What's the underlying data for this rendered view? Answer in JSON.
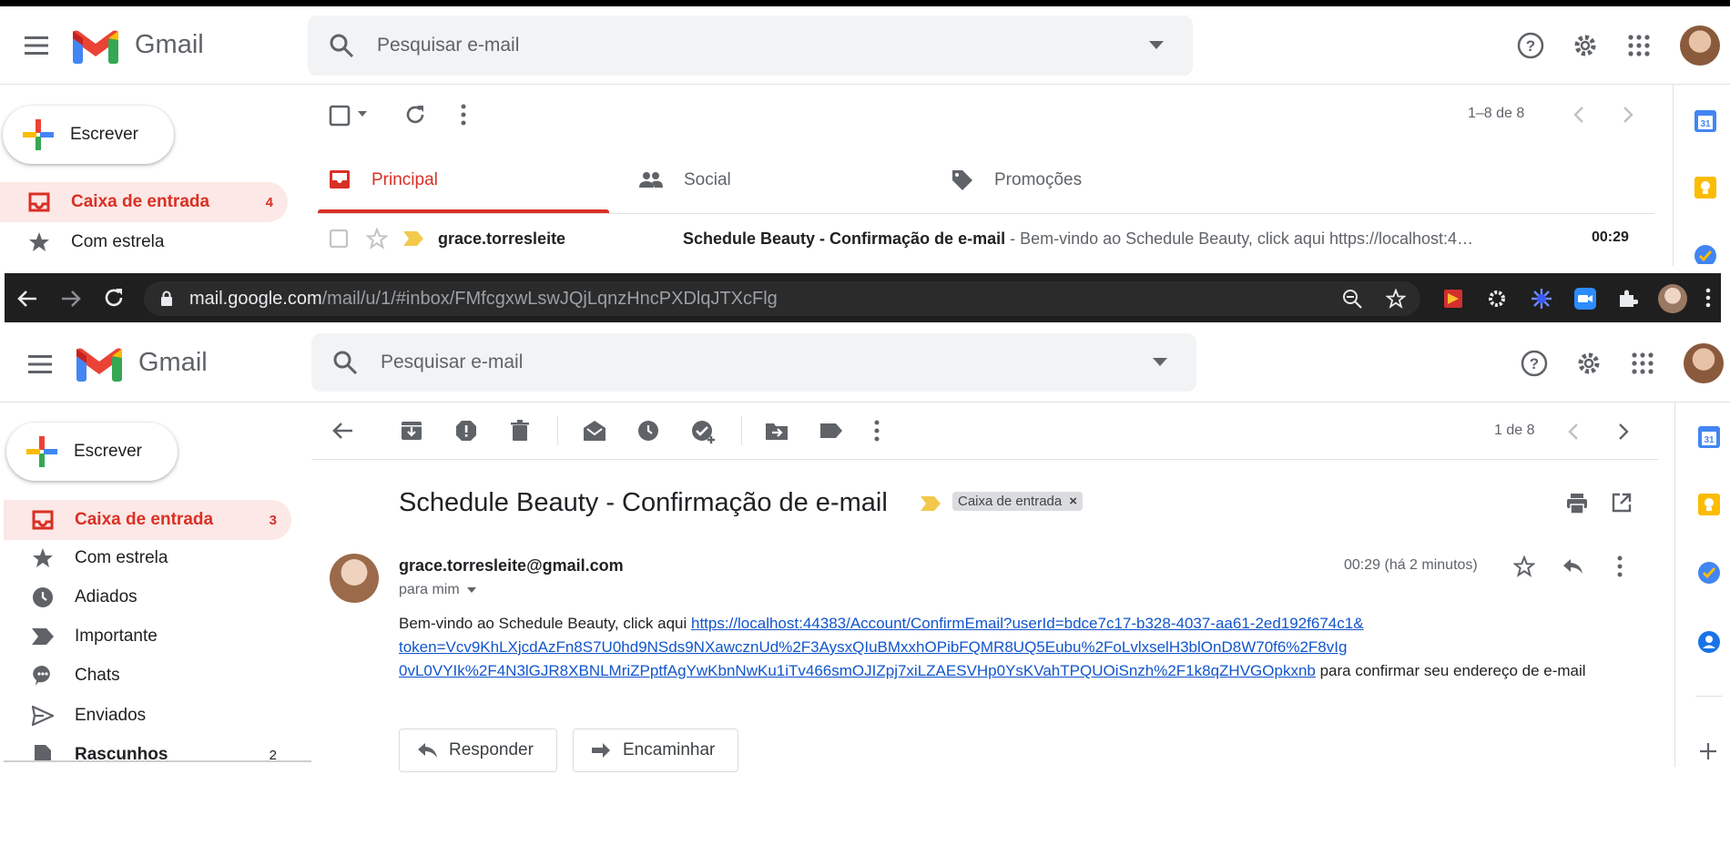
{
  "top": {
    "app_name": "Gmail",
    "search_placeholder": "Pesquisar e-mail",
    "compose_label": "Escrever",
    "sidebar": [
      {
        "label": "Caixa de entrada",
        "count": "4"
      },
      {
        "label": "Com estrela",
        "count": ""
      }
    ],
    "pagination": "1–8 de 8",
    "tabs": [
      {
        "label": "Principal"
      },
      {
        "label": "Social"
      },
      {
        "label": "Promoções"
      }
    ],
    "email_row": {
      "sender": "grace.torresleite",
      "subject": "Schedule Beauty - Confirmação de e-mail",
      "snippet": " - Bem-vindo ao Schedule Beauty, click aqui https://localhost:4…",
      "time": "00:29"
    }
  },
  "browser": {
    "url_host": "mail.google.com",
    "url_path": "/mail/u/1/#inbox/FMfcgxwLswJQjLqnzHncPXDlqJTXcFlg"
  },
  "bottom": {
    "app_name": "Gmail",
    "search_placeholder": "Pesquisar e-mail",
    "compose_label": "Escrever",
    "sidebar": [
      {
        "label": "Caixa de entrada",
        "count": "3"
      },
      {
        "label": "Com estrela",
        "count": ""
      },
      {
        "label": "Adiados",
        "count": ""
      },
      {
        "label": "Importante",
        "count": ""
      },
      {
        "label": "Chats",
        "count": ""
      },
      {
        "label": "Enviados",
        "count": ""
      },
      {
        "label": "Rascunhos",
        "count": "2"
      }
    ],
    "pagination": "1 de 8",
    "subject": "Schedule Beauty - Confirmação de e-mail",
    "label_chip": "Caixa de entrada",
    "label_chip_close": "×",
    "sender_email": "grace.torresleite@gmail.com",
    "recipient": "para mim",
    "timestamp": "00:29 (há 2 minutos)",
    "body_intro": "Bem-vindo ao Schedule Beauty, click aqui ",
    "body_link_1": "https://localhost:44383/Account/ConfirmEmail?userId=bdce7c17-b328-4037-aa61-2ed192f674c1&",
    "body_link_2": "token=Vcv9KhLXjcdAzFn8S7U0hd9NSds9NXawcznUd%2F3AysxQIuBMxxhOPibFQMR8UQ5Eubu%2FoLvlxselH3blOnD8W70f6%2F8vIg",
    "body_link_3": "0vL0VYIk%2F4N3lGJR8XBNLMriZPptfAgYwKbnNwKu1iTv466smOJIZpj7xiLZAESVHp0YsKVahTPQUOiSnzh%2F1k8qZHVGOpkxnb",
    "body_outro": " para confirmar seu endereço de e-mail",
    "reply_label": "Responder",
    "forward_label": "Encaminhar"
  },
  "colors": {
    "gmail_red": "#d93025",
    "active_bg": "#fce8e6",
    "link": "#1155cc",
    "chrome_bg": "#1f1f1f"
  }
}
